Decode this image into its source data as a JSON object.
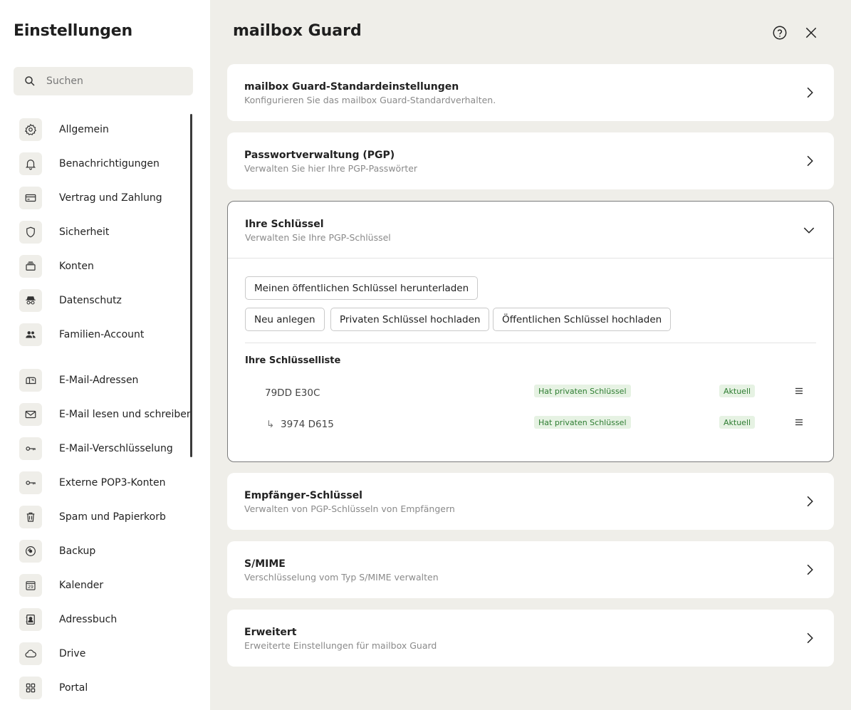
{
  "sidebar": {
    "title": "Einstellungen",
    "search": {
      "placeholder": "Suchen",
      "value": ""
    },
    "items": [
      {
        "label": "Allgemein",
        "icon": "gear-icon"
      },
      {
        "label": "Benachrichtigungen",
        "icon": "bell-icon"
      },
      {
        "label": "Vertrag und Zahlung",
        "icon": "credit-card-icon"
      },
      {
        "label": "Sicherheit",
        "icon": "shield-icon"
      },
      {
        "label": "Konten",
        "icon": "stack-icon"
      },
      {
        "label": "Datenschutz",
        "icon": "incognito-icon"
      },
      {
        "label": "Familien-Account",
        "icon": "people-icon"
      },
      {
        "label": "E-Mail-Adressen",
        "icon": "mailbox-icon"
      },
      {
        "label": "E-Mail lesen und schreiben",
        "icon": "envelope-icon"
      },
      {
        "label": "E-Mail-Verschlüsselung",
        "icon": "key-icon"
      },
      {
        "label": "Externe POP3-Konten",
        "icon": "key-icon"
      },
      {
        "label": "Spam und Papierkorb",
        "icon": "trash-icon"
      },
      {
        "label": "Backup",
        "icon": "disc-icon"
      },
      {
        "label": "Kalender",
        "icon": "calendar-icon",
        "badge": "29"
      },
      {
        "label": "Adressbuch",
        "icon": "contact-book-icon"
      },
      {
        "label": "Drive",
        "icon": "cloud-icon"
      },
      {
        "label": "Portal",
        "icon": "grid-icon"
      }
    ]
  },
  "main": {
    "title": "mailbox Guard",
    "help_icon": "help-icon",
    "close_icon": "close-icon",
    "cards": {
      "defaults": {
        "title": "mailbox Guard-Standardeinstellungen",
        "subtitle": "Konfigurieren Sie das mailbox Guard-Standardverhalten."
      },
      "passwords": {
        "title": "Passwortverwaltung (PGP)",
        "subtitle": "Verwalten Sie hier Ihre PGP-Passwörter"
      },
      "keys": {
        "title": "Ihre Schlüssel",
        "subtitle": "Verwalten Sie Ihre PGP-Schlüssel",
        "buttons": {
          "download_public": "Meinen öffentlichen Schlüssel herunterladen",
          "create_new": "Neu anlegen",
          "upload_private": "Privaten Schlüssel hochladen",
          "upload_public": "Öffentlichen Schlüssel hochladen"
        },
        "list_title": "Ihre Schlüsselliste",
        "list": [
          {
            "id": "79DD E30C",
            "prefix": "",
            "badge_private": "Hat privaten Schlüssel",
            "badge_status": "Aktuell"
          },
          {
            "id": "3974 D615",
            "prefix": "↳",
            "badge_private": "Hat privaten Schlüssel",
            "badge_status": "Aktuell"
          }
        ]
      },
      "recipients": {
        "title": "Empfänger-Schlüssel",
        "subtitle": "Verwalten von PGP-Schlüsseln von Empfängern"
      },
      "smime": {
        "title": "S/MIME",
        "subtitle": "Verschlüsselung vom Typ S/MIME verwalten"
      },
      "advanced": {
        "title": "Erweitert",
        "subtitle": "Erweiterte Einstellungen für mailbox Guard"
      }
    }
  }
}
